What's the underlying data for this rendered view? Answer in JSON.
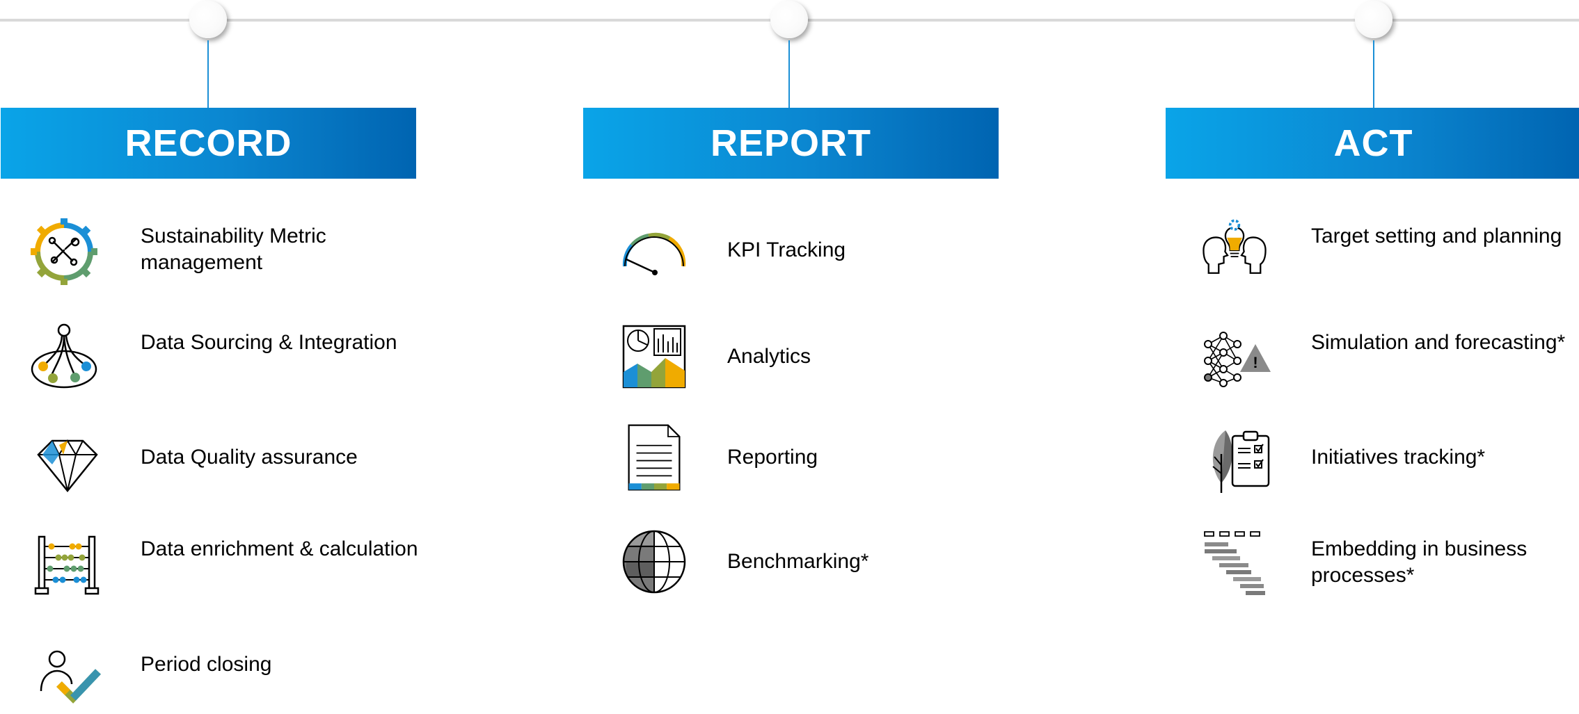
{
  "columns": [
    {
      "title": "RECORD",
      "items": [
        {
          "label": "Sustainability Metric management",
          "icon": "gear-wrench-icon"
        },
        {
          "label": "Data Sourcing & Integration",
          "icon": "data-network-icon"
        },
        {
          "label": "Data Quality assurance",
          "icon": "diamond-icon"
        },
        {
          "label": "Data enrichment & calculation",
          "icon": "abacus-icon"
        },
        {
          "label": "Period closing",
          "icon": "user-checkmark-icon"
        }
      ]
    },
    {
      "title": "REPORT",
      "items": [
        {
          "label": "KPI Tracking",
          "icon": "gauge-icon"
        },
        {
          "label": "Analytics",
          "icon": "analytics-chart-icon"
        },
        {
          "label": "Reporting",
          "icon": "document-icon"
        },
        {
          "label": "Benchmarking*",
          "icon": "globe-icon"
        }
      ]
    },
    {
      "title": "ACT",
      "items": [
        {
          "label": "Target setting and planning",
          "icon": "heads-lightbulb-icon"
        },
        {
          "label": "Simulation and forecasting*",
          "icon": "neural-network-warning-icon"
        },
        {
          "label": "Initiatives tracking*",
          "icon": "leaf-clipboard-icon"
        },
        {
          "label": "Embedding in business processes*",
          "icon": "gantt-icon"
        }
      ]
    }
  ],
  "colors": {
    "header_start": "#0aa4e8",
    "header_end": "#0064b1",
    "stem": "#1b8fd6",
    "yellow": "#f0ab00",
    "blue": "#1b8fd6",
    "green": "#5f9d6e",
    "olive": "#93a43a"
  }
}
